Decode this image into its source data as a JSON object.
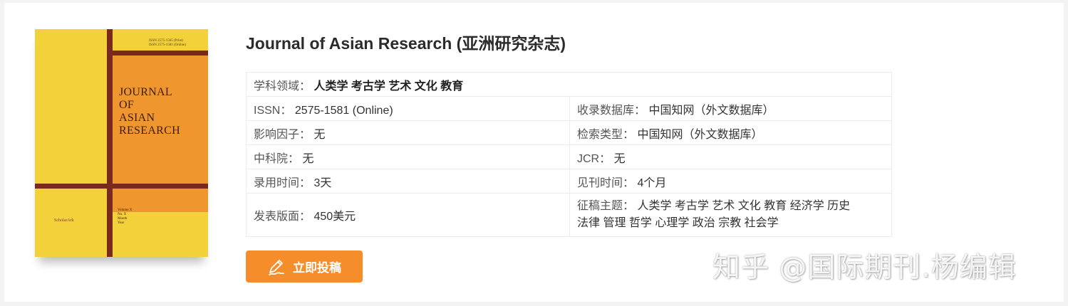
{
  "journal": {
    "title": "Journal of Asian Research (亚洲研究杂志)"
  },
  "cover": {
    "issn_lines": "ISSN 2575-1565 (Print)\nISSN 2575-1581 (Online)",
    "title": "JOURNAL\nOF\nASIAN\nRESEARCH",
    "publisher": "ScholarArk",
    "volume": "Volume X\nNo. X\nMonth\nYear",
    "colors": {
      "yellow": "#f2d13a",
      "orange": "#f0962f",
      "bar": "#7a2a1c"
    }
  },
  "info": {
    "subject": {
      "label": "学科领域：",
      "value": "人类学 考古学 艺术 文化 教育"
    },
    "issn": {
      "label": "ISSN：",
      "value": "2575-1581 (Online)"
    },
    "database": {
      "label": "收录数据库：",
      "value": "中国知网（外文数据库）"
    },
    "impact": {
      "label": "影响因子：",
      "value": "无"
    },
    "search_type": {
      "label": "检索类型：",
      "value": "中国知网（外文数据库）"
    },
    "cas": {
      "label": "中科院：",
      "value": "无"
    },
    "jcr": {
      "label": "JCR：",
      "value": "无"
    },
    "accept_time": {
      "label": "录用时间：",
      "value": "3天"
    },
    "publish_time": {
      "label": "见刊时间：",
      "value": "4个月"
    },
    "fee": {
      "label": "发表版面：",
      "value": "450美元"
    },
    "topics": {
      "label": "征稿主题：",
      "value_line1": "人类学 考古学 艺术 文化 教育 经济学 历史",
      "value_line2": "法律 管理 哲学 心理学 政治 宗教 社会学"
    }
  },
  "button": {
    "label": "立即投稿",
    "icon": "pen-icon",
    "color": "#f58e2a"
  },
  "watermark": "知乎 @国际期刊.杨编辑"
}
